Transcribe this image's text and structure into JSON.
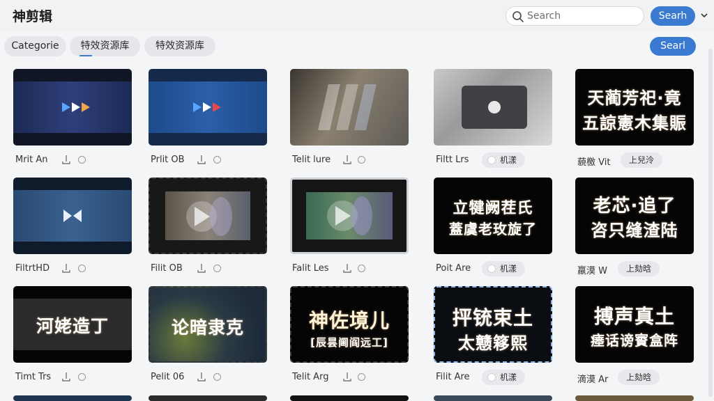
{
  "app": {
    "title": "神剪辑"
  },
  "search": {
    "placeholder": "Search",
    "button": "Searh"
  },
  "filters": [
    {
      "label": "Categorie"
    },
    {
      "label": "特效资源库"
    },
    {
      "label": "特效资源库"
    }
  ],
  "top_right_button": "Searl",
  "cards": [
    {
      "name": "Mrit An",
      "thumb_text": "",
      "sub_text": ""
    },
    {
      "name": "Prlit OB",
      "thumb_text": "",
      "sub_text": ""
    },
    {
      "name": "Telit lure",
      "thumb_text": "",
      "sub_text": ""
    },
    {
      "name": "Filtt Lrs",
      "pill": "机漾",
      "thumb_text": "",
      "sub_text": ""
    },
    {
      "name": "藐檄 Vit",
      "pill": "上兒泠",
      "thumb_text": "天蔺芳祀·竟",
      "sub_text": "五諒憲木集賑"
    },
    {
      "name": "FiltrtHD",
      "thumb_text": "",
      "sub_text": ""
    },
    {
      "name": "Filit OB",
      "thumb_text": "",
      "sub_text": ""
    },
    {
      "name": "Falit Les",
      "thumb_text": "",
      "sub_text": ""
    },
    {
      "name": "Poit Are",
      "pill": "机漾",
      "thumb_text": "立犍阙茬氏",
      "sub_text": "蓋虞老玫旋了"
    },
    {
      "name": "羸漠 W",
      "pill": "上劾晗",
      "thumb_text": "老芯·追了",
      "sub_text": "咨只缝渣陆"
    },
    {
      "name": "Timt Trs",
      "thumb_text": "河姥造丁",
      "sub_text": ""
    },
    {
      "name": "Pelit 06",
      "thumb_text": "论暗隶克",
      "sub_text": ""
    },
    {
      "name": "Telit Arg",
      "thumb_text": "神佐境儿",
      "sub_text": "[辰昙阃阎远工]"
    },
    {
      "name": "Filit Are",
      "pill": "机漾",
      "thumb_text": "抨铳束土",
      "sub_text": "太戆簃熙"
    },
    {
      "name": "滴漠 Ar",
      "pill": "上劾晗",
      "thumb_text": "搏声真土",
      "sub_text": "瘗话谤賨盒阵"
    }
  ]
}
